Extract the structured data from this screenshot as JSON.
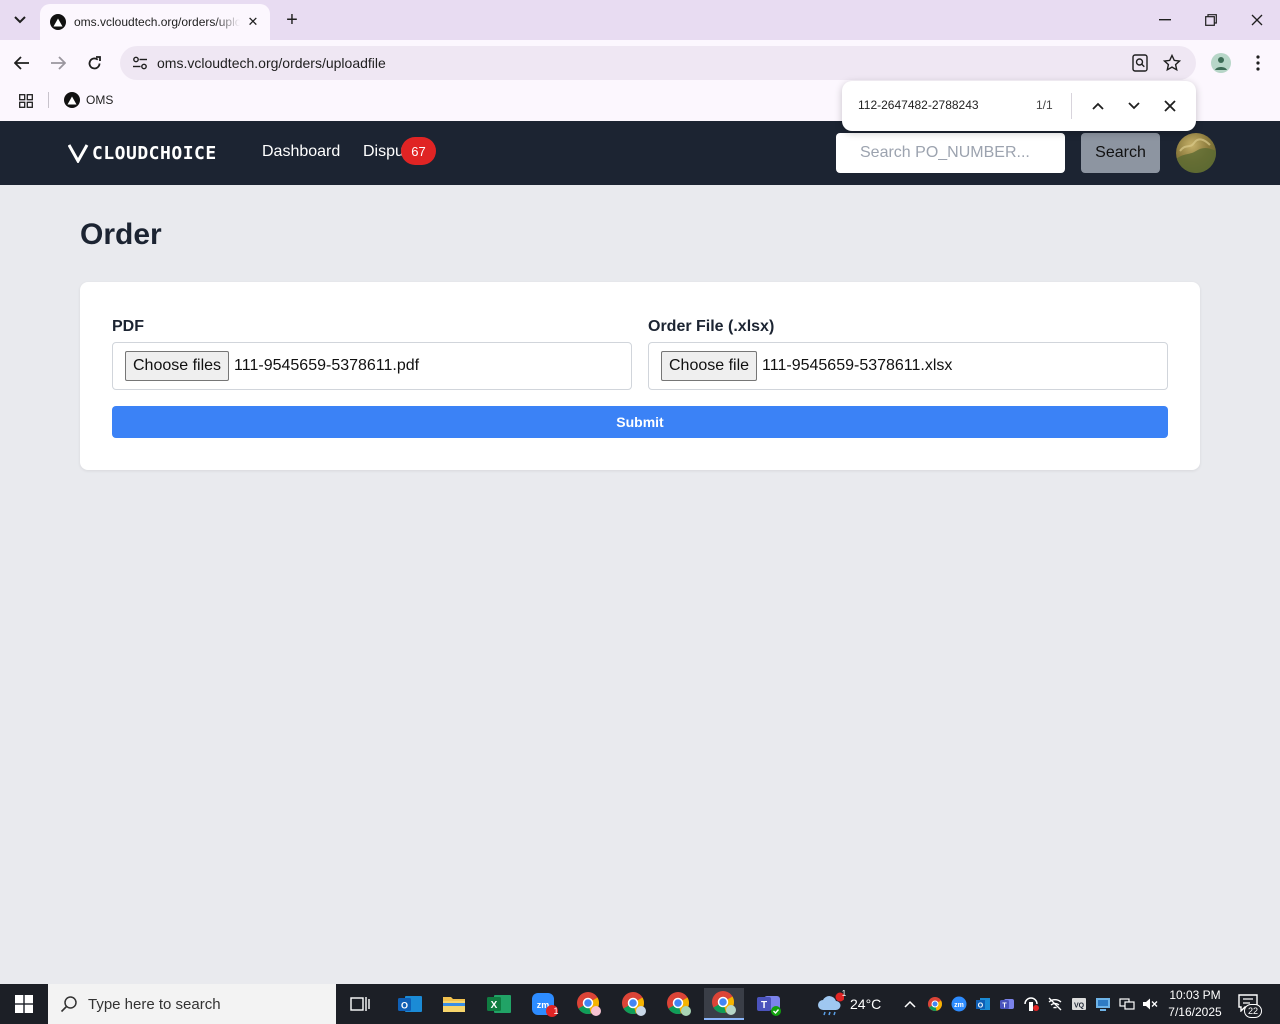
{
  "browser": {
    "tab_title": "oms.vcloudtech.org/orders/uploadfile",
    "url": "oms.vcloudtech.org/orders/uploadfile",
    "bookmark_label": "OMS",
    "find": {
      "query": "112-2647482-2788243",
      "count": "1/1"
    }
  },
  "app": {
    "logo_text": "CLOUDCHOICE",
    "nav": {
      "dashboard": "Dashboard",
      "disputes": "Dispu",
      "disputes_badge": "67"
    },
    "search": {
      "placeholder": "Search PO_NUMBER...",
      "button": "Search"
    }
  },
  "page": {
    "title": "Order",
    "pdf": {
      "label": "PDF",
      "button": "Choose files",
      "file": "111-9545659-5378611.pdf"
    },
    "order_file": {
      "label": "Order File (.xlsx)",
      "button": "Choose file",
      "file": "111-9545659-5378611.xlsx"
    },
    "submit": "Submit"
  },
  "taskbar": {
    "search_placeholder": "Type here to search",
    "weather_temp": "24°C",
    "weather_badge": "1",
    "zoom_badge": "1",
    "time": "10:03 PM",
    "date": "7/16/2025",
    "notifications": "22"
  },
  "colors": {
    "nav_bg": "#1c2432",
    "submit": "#3b82f6",
    "badge": "#e02424",
    "page_bg": "#e9eaee"
  }
}
